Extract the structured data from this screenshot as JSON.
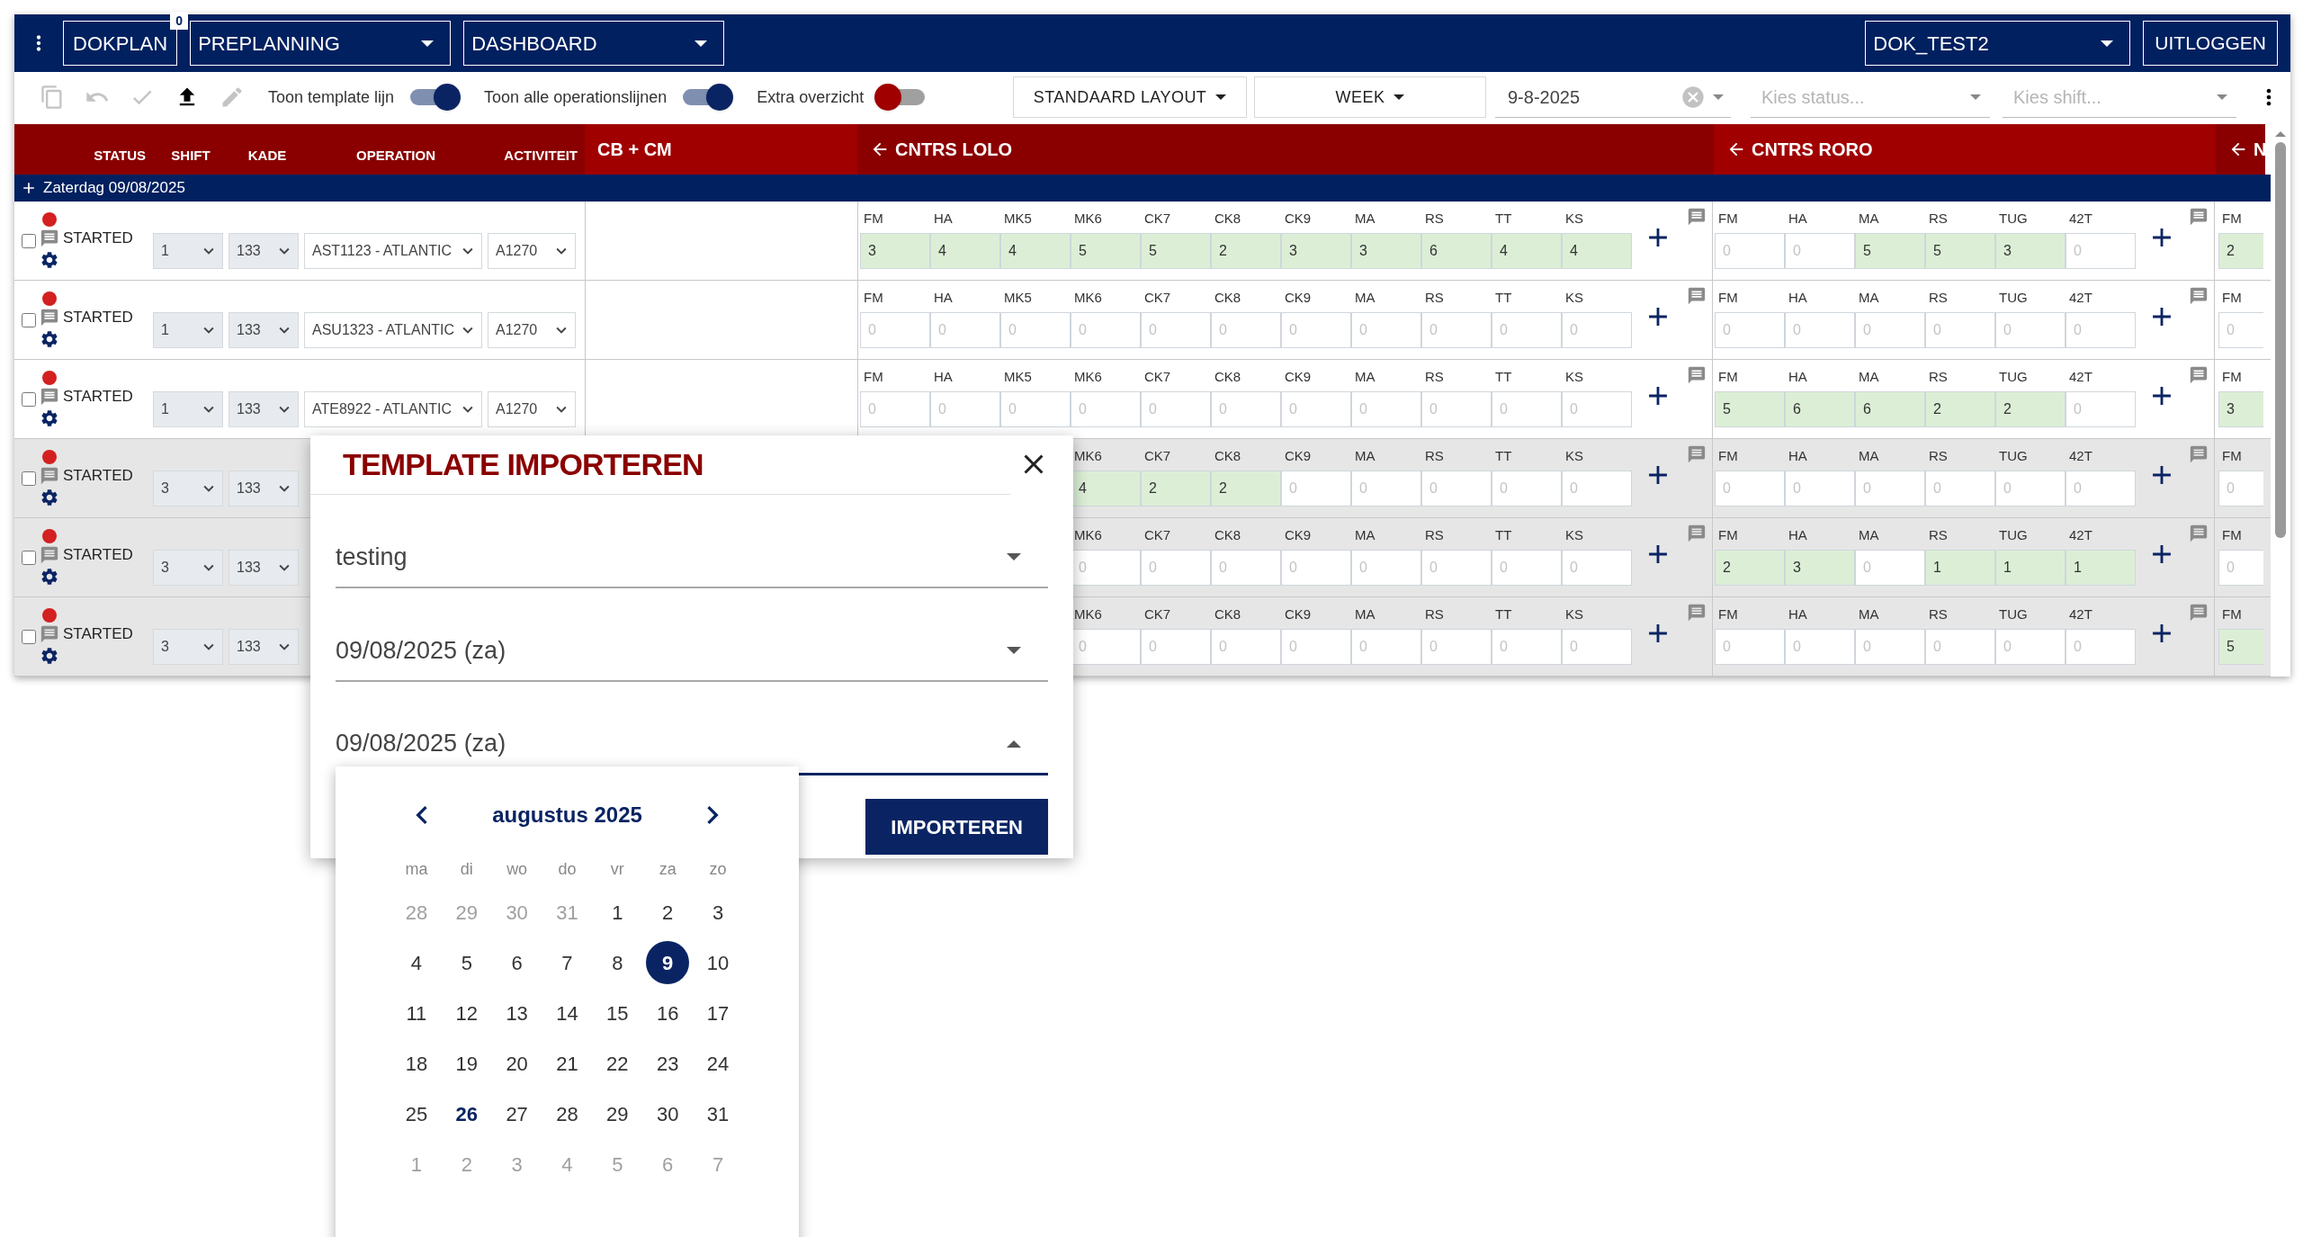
{
  "topbar": {
    "app_button": {
      "label": "DOKPLAN",
      "badge": "0"
    },
    "selects": [
      {
        "value": "PREPLANNING"
      },
      {
        "value": "DASHBOARD"
      }
    ],
    "user_select": {
      "value": "DOK_TEST2"
    },
    "logout": "UITLOGGEN"
  },
  "toolbar": {
    "actions": [
      {
        "kind": "copy",
        "disabled": true
      },
      {
        "kind": "undo",
        "disabled": true
      },
      {
        "kind": "check",
        "disabled": true
      },
      {
        "kind": "upload",
        "disabled": false
      },
      {
        "kind": "edit",
        "disabled": true
      }
    ],
    "toggles": [
      {
        "label": "Toon template lijn",
        "on": true
      },
      {
        "label": "Toon alle operationslijnen",
        "on": true
      },
      {
        "label": "Extra overzicht",
        "on": false
      }
    ],
    "layout_button": "STANDAARD LAYOUT",
    "period_button": "WEEK",
    "date_field": {
      "value": "9-8-2025"
    },
    "status_filter": {
      "placeholder": "Kies status..."
    },
    "shift_filter": {
      "placeholder": "Kies shift..."
    }
  },
  "header": {
    "columns": [
      "STATUS",
      "SHIFT",
      "KADE",
      "OPERATION",
      "ACTIVITEIT"
    ],
    "groups": [
      {
        "label": "CB + CM",
        "arrow": false
      },
      {
        "label": "CNTRS LOLO",
        "arrow": true
      },
      {
        "label": "CNTRS RORO",
        "arrow": true
      },
      {
        "label": "N",
        "arrow": true
      }
    ]
  },
  "day": {
    "label": "Zaterdag 09/08/2025"
  },
  "rows": [
    {
      "checked": false,
      "shaded": false,
      "status": "STARTED",
      "shift": "1",
      "kade": "133",
      "operation": "AST1123 - ATLANTIC",
      "activiteit": "A1270",
      "groups": [
        {
          "fields": [
            {
              "label": "FM",
              "value": "3"
            },
            {
              "label": "HA",
              "value": "4"
            },
            {
              "label": "MK5",
              "value": "4"
            },
            {
              "label": "MK6",
              "value": "5"
            },
            {
              "label": "CK7",
              "value": "5"
            },
            {
              "label": "CK8",
              "value": "2"
            },
            {
              "label": "CK9",
              "value": "3"
            },
            {
              "label": "MA",
              "value": "3"
            },
            {
              "label": "RS",
              "value": "6"
            },
            {
              "label": "TT",
              "value": "4"
            },
            {
              "label": "KS",
              "value": "4"
            }
          ]
        },
        {
          "fields": [
            {
              "label": "FM",
              "placeholder": "0"
            },
            {
              "label": "HA",
              "placeholder": "0"
            },
            {
              "label": "MA",
              "value": "5"
            },
            {
              "label": "RS",
              "value": "5"
            },
            {
              "label": "TUG",
              "value": "3"
            },
            {
              "label": "42T",
              "placeholder": "0"
            }
          ]
        },
        {
          "fields": [
            {
              "label": "FM",
              "value": "2"
            }
          ]
        }
      ]
    },
    {
      "checked": false,
      "shaded": false,
      "status": "STARTED",
      "shift": "1",
      "kade": "133",
      "operation": "ASU1323 - ATLANTIC",
      "activiteit": "A1270",
      "groups": [
        {
          "fields": [
            {
              "label": "FM",
              "placeholder": "0"
            },
            {
              "label": "HA",
              "placeholder": "0"
            },
            {
              "label": "MK5",
              "placeholder": "0"
            },
            {
              "label": "MK6",
              "placeholder": "0"
            },
            {
              "label": "CK7",
              "placeholder": "0"
            },
            {
              "label": "CK8",
              "placeholder": "0"
            },
            {
              "label": "CK9",
              "placeholder": "0"
            },
            {
              "label": "MA",
              "placeholder": "0"
            },
            {
              "label": "RS",
              "placeholder": "0"
            },
            {
              "label": "TT",
              "placeholder": "0"
            },
            {
              "label": "KS",
              "placeholder": "0"
            }
          ]
        },
        {
          "fields": [
            {
              "label": "FM",
              "placeholder": "0"
            },
            {
              "label": "HA",
              "placeholder": "0"
            },
            {
              "label": "MA",
              "placeholder": "0"
            },
            {
              "label": "RS",
              "placeholder": "0"
            },
            {
              "label": "TUG",
              "placeholder": "0"
            },
            {
              "label": "42T",
              "placeholder": "0"
            }
          ]
        },
        {
          "fields": [
            {
              "label": "FM",
              "placeholder": "0"
            }
          ]
        }
      ]
    },
    {
      "checked": false,
      "shaded": false,
      "status": "STARTED",
      "shift": "1",
      "kade": "133",
      "operation": "ATE8922 - ATLANTIC",
      "activiteit": "A1270",
      "groups": [
        {
          "fields": [
            {
              "label": "FM",
              "placeholder": "0"
            },
            {
              "label": "HA",
              "placeholder": "0"
            },
            {
              "label": "MK5",
              "placeholder": "0"
            },
            {
              "label": "MK6",
              "placeholder": "0"
            },
            {
              "label": "CK7",
              "placeholder": "0"
            },
            {
              "label": "CK8",
              "placeholder": "0"
            },
            {
              "label": "CK9",
              "placeholder": "0"
            },
            {
              "label": "MA",
              "placeholder": "0"
            },
            {
              "label": "RS",
              "placeholder": "0"
            },
            {
              "label": "TT",
              "placeholder": "0"
            },
            {
              "label": "KS",
              "placeholder": "0"
            }
          ]
        },
        {
          "fields": [
            {
              "label": "FM",
              "value": "5"
            },
            {
              "label": "HA",
              "value": "6"
            },
            {
              "label": "MA",
              "value": "6"
            },
            {
              "label": "RS",
              "value": "2"
            },
            {
              "label": "TUG",
              "value": "2"
            },
            {
              "label": "42T",
              "placeholder": "0"
            }
          ]
        },
        {
          "fields": [
            {
              "label": "FM",
              "value": "3"
            }
          ]
        }
      ]
    },
    {
      "checked": false,
      "shaded": true,
      "status": "STARTED",
      "shift": "3",
      "kade": "133",
      "groups": [
        {
          "fields": [
            {
              "label": "MK6",
              "value": "4"
            },
            {
              "label": "CK7",
              "value": "2"
            },
            {
              "label": "CK8",
              "value": "2"
            },
            {
              "label": "CK9",
              "placeholder": "0"
            },
            {
              "label": "MA",
              "placeholder": "0"
            },
            {
              "label": "RS",
              "placeholder": "0"
            },
            {
              "label": "TT",
              "placeholder": "0"
            },
            {
              "label": "KS",
              "placeholder": "0"
            }
          ]
        },
        {
          "fields": [
            {
              "label": "FM",
              "placeholder": "0"
            },
            {
              "label": "HA",
              "placeholder": "0"
            },
            {
              "label": "MA",
              "placeholder": "0"
            },
            {
              "label": "RS",
              "placeholder": "0"
            },
            {
              "label": "TUG",
              "placeholder": "0"
            },
            {
              "label": "42T",
              "placeholder": "0"
            }
          ]
        },
        {
          "fields": [
            {
              "label": "FM",
              "placeholder": "0"
            }
          ]
        }
      ]
    },
    {
      "checked": false,
      "shaded": true,
      "status": "STARTED",
      "shift": "3",
      "kade": "133",
      "groups": [
        {
          "fields": [
            {
              "label": "MK6",
              "placeholder": "0"
            },
            {
              "label": "CK7",
              "placeholder": "0"
            },
            {
              "label": "CK8",
              "placeholder": "0"
            },
            {
              "label": "CK9",
              "placeholder": "0"
            },
            {
              "label": "MA",
              "placeholder": "0"
            },
            {
              "label": "RS",
              "placeholder": "0"
            },
            {
              "label": "TT",
              "placeholder": "0"
            },
            {
              "label": "KS",
              "placeholder": "0"
            }
          ]
        },
        {
          "fields": [
            {
              "label": "FM",
              "value": "2"
            },
            {
              "label": "HA",
              "value": "3"
            },
            {
              "label": "MA",
              "placeholder": "0"
            },
            {
              "label": "RS",
              "value": "1"
            },
            {
              "label": "TUG",
              "value": "1"
            },
            {
              "label": "42T",
              "value": "1"
            }
          ]
        },
        {
          "fields": [
            {
              "label": "FM",
              "placeholder": "0"
            }
          ]
        }
      ]
    },
    {
      "checked": false,
      "shaded": true,
      "status": "STARTED",
      "shift": "3",
      "kade": "133",
      "groups": [
        {
          "fields": [
            {
              "label": "MK6",
              "placeholder": "0"
            },
            {
              "label": "CK7",
              "placeholder": "0"
            },
            {
              "label": "CK8",
              "placeholder": "0"
            },
            {
              "label": "CK9",
              "placeholder": "0"
            },
            {
              "label": "MA",
              "placeholder": "0"
            },
            {
              "label": "RS",
              "placeholder": "0"
            },
            {
              "label": "TT",
              "placeholder": "0"
            },
            {
              "label": "KS",
              "placeholder": "0"
            }
          ]
        },
        {
          "fields": [
            {
              "label": "FM",
              "placeholder": "0"
            },
            {
              "label": "HA",
              "placeholder": "0"
            },
            {
              "label": "MA",
              "placeholder": "0"
            },
            {
              "label": "RS",
              "placeholder": "0"
            },
            {
              "label": "TUG",
              "placeholder": "0"
            },
            {
              "label": "42T",
              "placeholder": "0"
            }
          ]
        },
        {
          "fields": [
            {
              "label": "FM",
              "value": "5"
            }
          ]
        }
      ]
    }
  ],
  "dialog": {
    "title": "TEMPLATE IMPORTEREN",
    "fields": [
      {
        "value": "testing",
        "open": false
      },
      {
        "value": "09/08/2025 (za)",
        "open": false
      },
      {
        "value": "09/08/2025 (za)",
        "open": true
      }
    ],
    "button": "IMPORTEREN",
    "calendar": {
      "month": "augustus 2025",
      "weekdays": [
        "ma",
        "di",
        "wo",
        "do",
        "vr",
        "za",
        "zo"
      ],
      "weeks": [
        [
          {
            "day": "28",
            "outside": true,
            "selected": false,
            "today": false
          },
          {
            "day": "29",
            "outside": true,
            "selected": false,
            "today": false
          },
          {
            "day": "30",
            "outside": true,
            "selected": false,
            "today": false
          },
          {
            "day": "31",
            "outside": true,
            "selected": false,
            "today": false
          },
          {
            "day": "1",
            "outside": false,
            "selected": false,
            "today": false
          },
          {
            "day": "2",
            "outside": false,
            "selected": false,
            "today": false
          },
          {
            "day": "3",
            "outside": false,
            "selected": false,
            "today": false
          }
        ],
        [
          {
            "day": "4",
            "outside": false,
            "selected": false,
            "today": false
          },
          {
            "day": "5",
            "outside": false,
            "selected": false,
            "today": false
          },
          {
            "day": "6",
            "outside": false,
            "selected": false,
            "today": false
          },
          {
            "day": "7",
            "outside": false,
            "selected": false,
            "today": false
          },
          {
            "day": "8",
            "outside": false,
            "selected": false,
            "today": false
          },
          {
            "day": "9",
            "outside": false,
            "selected": true,
            "today": false
          },
          {
            "day": "10",
            "outside": false,
            "selected": false,
            "today": false
          }
        ],
        [
          {
            "day": "11",
            "outside": false,
            "selected": false,
            "today": false
          },
          {
            "day": "12",
            "outside": false,
            "selected": false,
            "today": false
          },
          {
            "day": "13",
            "outside": false,
            "selected": false,
            "today": false
          },
          {
            "day": "14",
            "outside": false,
            "selected": false,
            "today": false
          },
          {
            "day": "15",
            "outside": false,
            "selected": false,
            "today": false
          },
          {
            "day": "16",
            "outside": false,
            "selected": false,
            "today": false
          },
          {
            "day": "17",
            "outside": false,
            "selected": false,
            "today": false
          }
        ],
        [
          {
            "day": "18",
            "outside": false,
            "selected": false,
            "today": false
          },
          {
            "day": "19",
            "outside": false,
            "selected": false,
            "today": false
          },
          {
            "day": "20",
            "outside": false,
            "selected": false,
            "today": false
          },
          {
            "day": "21",
            "outside": false,
            "selected": false,
            "today": false
          },
          {
            "day": "22",
            "outside": false,
            "selected": false,
            "today": false
          },
          {
            "day": "23",
            "outside": false,
            "selected": false,
            "today": false
          },
          {
            "day": "24",
            "outside": false,
            "selected": false,
            "today": false
          }
        ],
        [
          {
            "day": "25",
            "outside": false,
            "selected": false,
            "today": false
          },
          {
            "day": "26",
            "outside": false,
            "selected": false,
            "today": true
          },
          {
            "day": "27",
            "outside": false,
            "selected": false,
            "today": false
          },
          {
            "day": "28",
            "outside": false,
            "selected": false,
            "today": false
          },
          {
            "day": "29",
            "outside": false,
            "selected": false,
            "today": false
          },
          {
            "day": "30",
            "outside": false,
            "selected": false,
            "today": false
          },
          {
            "day": "31",
            "outside": false,
            "selected": false,
            "today": false
          }
        ],
        [
          {
            "day": "1",
            "outside": true,
            "selected": false,
            "today": false
          },
          {
            "day": "2",
            "outside": true,
            "selected": false,
            "today": false
          },
          {
            "day": "3",
            "outside": true,
            "selected": false,
            "today": false
          },
          {
            "day": "4",
            "outside": true,
            "selected": false,
            "today": false
          },
          {
            "day": "5",
            "outside": true,
            "selected": false,
            "today": false
          },
          {
            "day": "6",
            "outside": true,
            "selected": false,
            "today": false
          },
          {
            "day": "7",
            "outside": true,
            "selected": false,
            "today": false
          }
        ]
      ]
    }
  }
}
